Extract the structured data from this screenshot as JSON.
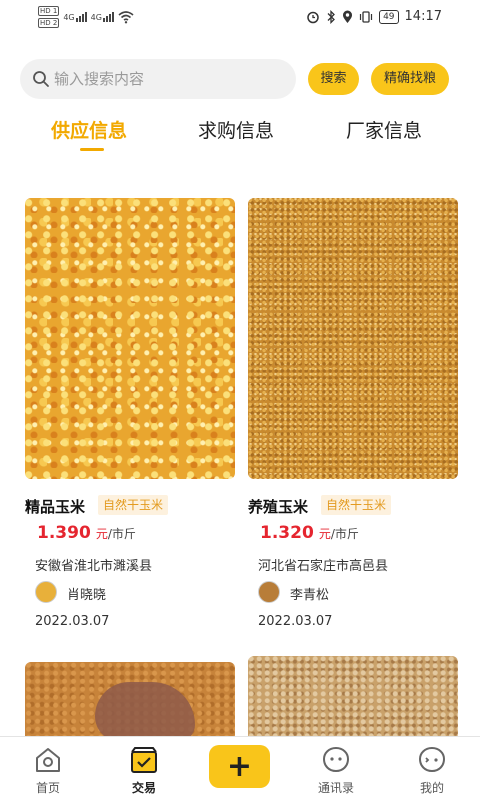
{
  "status_bar": {
    "hd1": "HD 1",
    "hd2": "HD 2",
    "net1": "4G",
    "net2": "4G",
    "battery": "49",
    "time": "14:17"
  },
  "search": {
    "placeholder": "输入搜索内容",
    "search_button": "搜索",
    "precise_button": "精确找粮"
  },
  "tabs": [
    {
      "label": "供应信息",
      "active": true
    },
    {
      "label": "求购信息",
      "active": false
    },
    {
      "label": "厂家信息",
      "active": false
    }
  ],
  "listings": [
    {
      "title": "精品玉米",
      "tag": "自然干玉米",
      "price": "1.390",
      "unit_yuan": "元",
      "unit_jin": "/市斤",
      "location": "安徽省淮北市濉溪县",
      "seller": "肖晓晓",
      "date": "2022.03.07"
    },
    {
      "title": "养殖玉米",
      "tag": "自然干玉米",
      "price": "1.320",
      "unit_yuan": "元",
      "unit_jin": "/市斤",
      "location": "河北省石家庄市高邑县",
      "seller": "李青松",
      "date": "2022.03.07"
    }
  ],
  "bottom_nav": {
    "home": "首页",
    "trade": "交易",
    "add": "+",
    "contacts": "通讯录",
    "mine": "我的"
  },
  "colors": {
    "accent": "#f9c51a",
    "tab_active": "#f2a900",
    "price": "#e5252f",
    "tag_text": "#e39a1f",
    "tag_bg": "#fdf1de"
  }
}
